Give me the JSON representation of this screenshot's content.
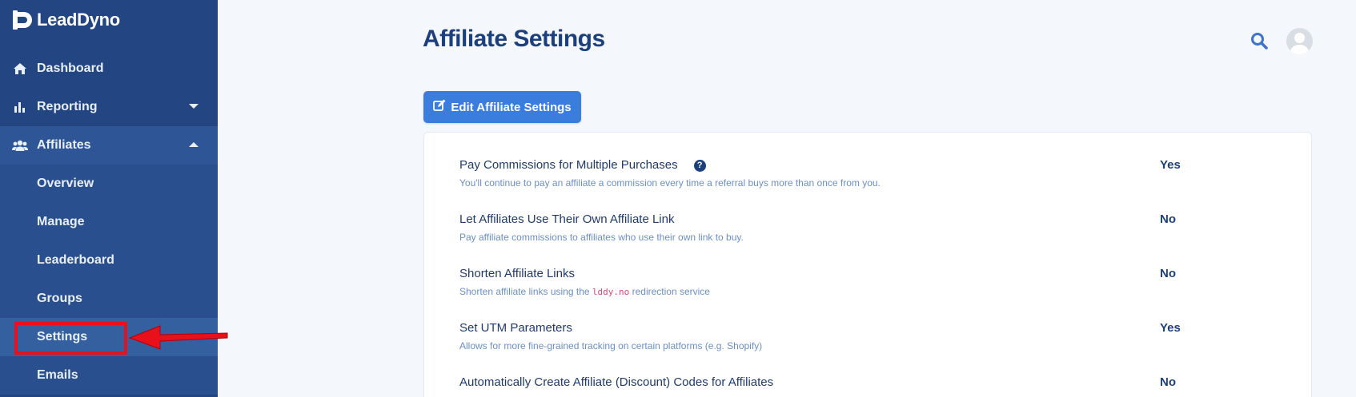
{
  "brand": {
    "name": "LeadDyno"
  },
  "sidebar": {
    "items": [
      {
        "label": "Dashboard",
        "icon": "home-icon"
      },
      {
        "label": "Reporting",
        "icon": "bar-chart-icon"
      },
      {
        "label": "Affiliates",
        "icon": "users-icon"
      }
    ],
    "sub_items": [
      {
        "label": "Overview"
      },
      {
        "label": "Manage"
      },
      {
        "label": "Leaderboard"
      },
      {
        "label": "Groups"
      },
      {
        "label": "Settings"
      },
      {
        "label": "Emails"
      }
    ]
  },
  "header": {
    "title": "Affiliate Settings"
  },
  "toolbar": {
    "edit_label": "Edit Affiliate Settings"
  },
  "settings": [
    {
      "title": "Pay Commissions for Multiple Purchases",
      "description": "You'll continue to pay an affiliate a commission every time a referral buys more than once from you.",
      "value": "Yes",
      "help": "?"
    },
    {
      "title": "Let Affiliates Use Their Own Affiliate Link",
      "description": "Pay affiliate commissions to affiliates who use their own link to buy.",
      "value": "No"
    },
    {
      "title": "Shorten Affiliate Links",
      "description_prefix": "Shorten affiliate links using the",
      "description_code": "lddy.no",
      "description_suffix": "redirection service",
      "value": "No"
    },
    {
      "title": "Set UTM Parameters",
      "description": "Allows for more fine-grained tracking on certain platforms (e.g. Shopify)",
      "value": "Yes"
    },
    {
      "title": "Automatically Create Affiliate (Discount) Codes for Affiliates",
      "value": "No"
    }
  ],
  "colors": {
    "sidebar_bg": "#234682",
    "accent": "#3b7ddd",
    "annotation_red": "#e8101a"
  }
}
